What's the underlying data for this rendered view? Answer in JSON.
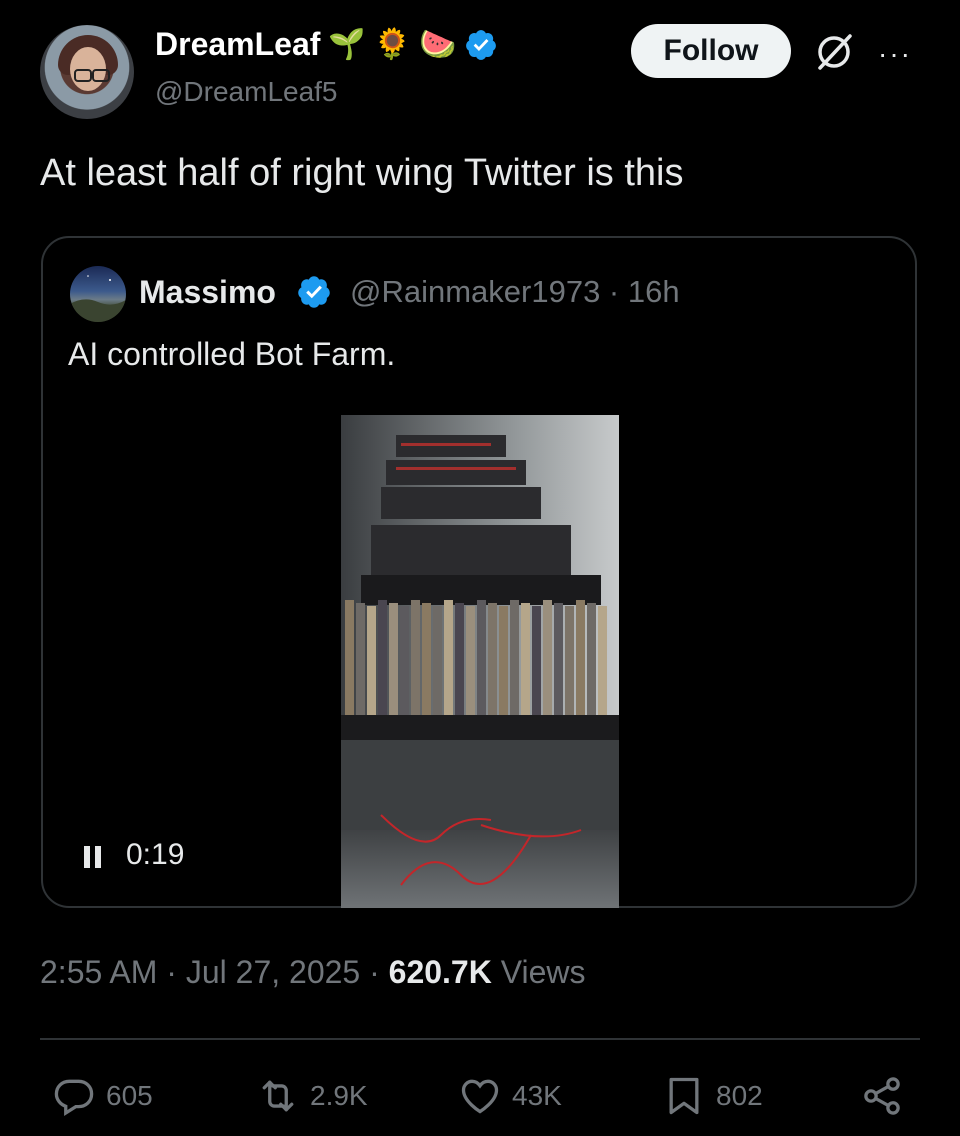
{
  "author": {
    "display_name": "DreamLeaf",
    "emojis": [
      "🌱",
      "🌻",
      "🍉"
    ],
    "handle": "@DreamLeaf5",
    "verified": true
  },
  "header": {
    "follow_label": "Follow",
    "more_label": "···"
  },
  "tweet": {
    "text": "At least half of right wing Twitter is this"
  },
  "quote": {
    "display_name": "Massimo",
    "verified": true,
    "handle_time": "@Rainmaker1973 · 16h",
    "text": "AI controlled Bot Farm.",
    "video": {
      "state": "playing",
      "time": "0:19"
    }
  },
  "meta": {
    "timestamp": "2:55 AM · Jul 27, 2025 · ",
    "views_count": "620.7K",
    "views_label": " Views"
  },
  "actions": {
    "replies": "605",
    "reposts": "2.9K",
    "likes": "43K",
    "bookmarks": "802"
  },
  "colors": {
    "background": "#000000",
    "text": "#e7e9ea",
    "secondary": "#71767b",
    "verified_blue": "#1d9bf0",
    "border": "#2f3336",
    "follow_bg": "#eff3f4"
  }
}
